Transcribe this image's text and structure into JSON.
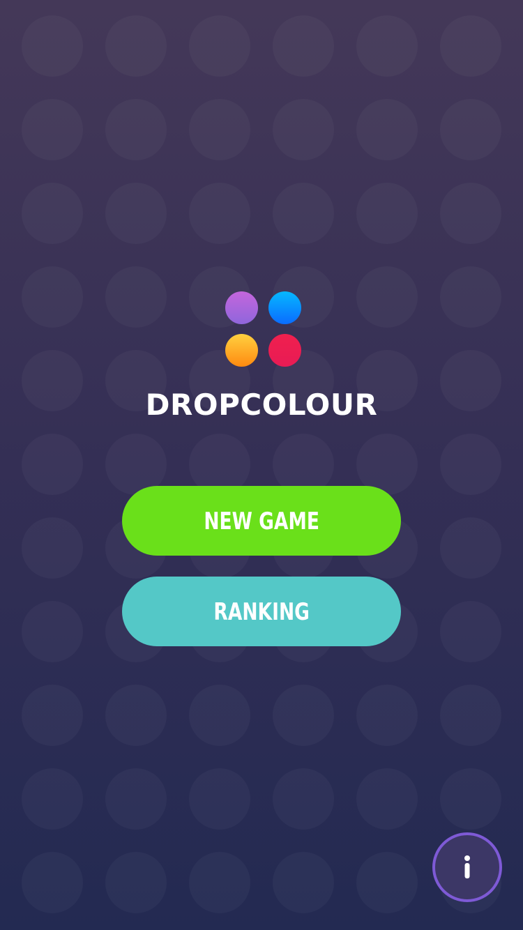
{
  "app": {
    "title": "DROPCOLOUR"
  },
  "logo": {
    "dots": [
      {
        "name": "purple",
        "colors": [
          "#c466dc",
          "#8f66dc"
        ]
      },
      {
        "name": "blue",
        "colors": [
          "#06b8ff",
          "#0a6cff"
        ]
      },
      {
        "name": "orange",
        "colors": [
          "#ffd040",
          "#ff8a10"
        ]
      },
      {
        "name": "red",
        "colors": [
          "#f0204e",
          "#e81b55"
        ]
      }
    ]
  },
  "menu": {
    "new_game_label": "NEW GAME",
    "ranking_label": "RANKING"
  },
  "info": {
    "icon": "info-icon"
  },
  "colors": {
    "background_top": "#443858",
    "background_bottom": "#232a52",
    "new_game_button": "#6ae01a",
    "ranking_button": "#54c8c7",
    "info_ring": "#7e5ad6"
  }
}
